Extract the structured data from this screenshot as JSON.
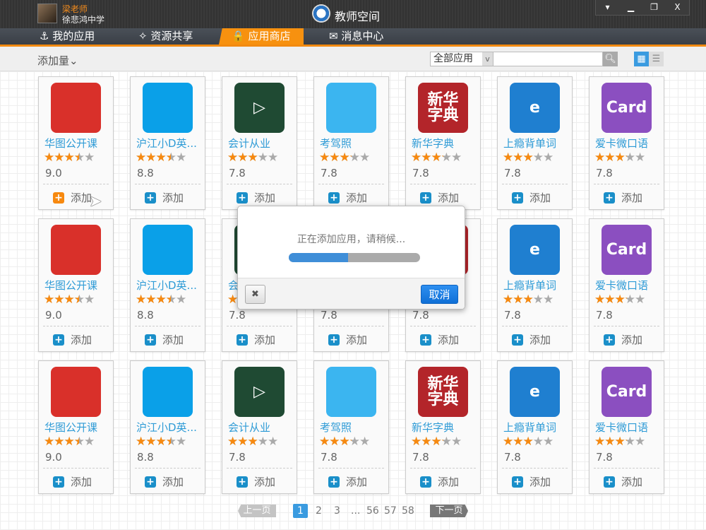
{
  "titlebar": {
    "user_name": "梁老师",
    "school": "徐悲鸿中学",
    "app_title": "教师空间",
    "controls": [
      "▾",
      "▁",
      "❐",
      "X"
    ]
  },
  "nav": {
    "tabs": [
      {
        "label": "我的应用",
        "icon": "anchor-icon"
      },
      {
        "label": "资源共享",
        "icon": "share-icon"
      },
      {
        "label": "应用商店",
        "icon": "shop-bag-icon",
        "active": true
      },
      {
        "label": "消息中心",
        "icon": "mail-icon"
      }
    ]
  },
  "toolbar": {
    "sort_label": "添加量",
    "filter_value": "全部应用",
    "search_placeholder": "",
    "view_mode": "grid"
  },
  "apps": [
    {
      "name": "华图公开课",
      "score": "9.0",
      "stars": 3.5,
      "icon_text": "",
      "icon_color": "#d9302a"
    },
    {
      "name": "沪江小D英...",
      "score": "8.8",
      "stars": 3.5,
      "icon_text": "",
      "icon_color": "#0aa0e8"
    },
    {
      "name": "会计从业",
      "score": "7.8",
      "stars": 3,
      "icon_text": "▷",
      "icon_color": "#1f4a33"
    },
    {
      "name": "考驾照",
      "score": "7.8",
      "stars": 3.2,
      "icon_text": "",
      "icon_color": "#3bb5f0"
    },
    {
      "name": "新华字典",
      "score": "7.8",
      "stars": 3.2,
      "icon_text": "新华\n字典",
      "icon_color": "#b3252a"
    },
    {
      "name": "上瘾背单词",
      "score": "7.8",
      "stars": 3,
      "icon_text": "e",
      "icon_color": "#1f7fd0"
    },
    {
      "name": "爱卡微口语",
      "score": "7.8",
      "stars": 3.2,
      "icon_text": "Card",
      "icon_color": "#8b4fc0"
    }
  ],
  "add_label": "添加",
  "pager": {
    "prev": "上一页",
    "next": "下一页",
    "pages": [
      "1",
      "2",
      "3",
      "...",
      "56",
      "57",
      "58"
    ],
    "current": "1"
  },
  "dialog": {
    "message": "正在添加应用，请稍候...",
    "progress_percent": 45,
    "cancel_label": "取消",
    "close_icon": "✖"
  },
  "colors": {
    "accent": "#f7910f",
    "link": "#2e9bd6",
    "primary_button": "#1a7fe0"
  }
}
